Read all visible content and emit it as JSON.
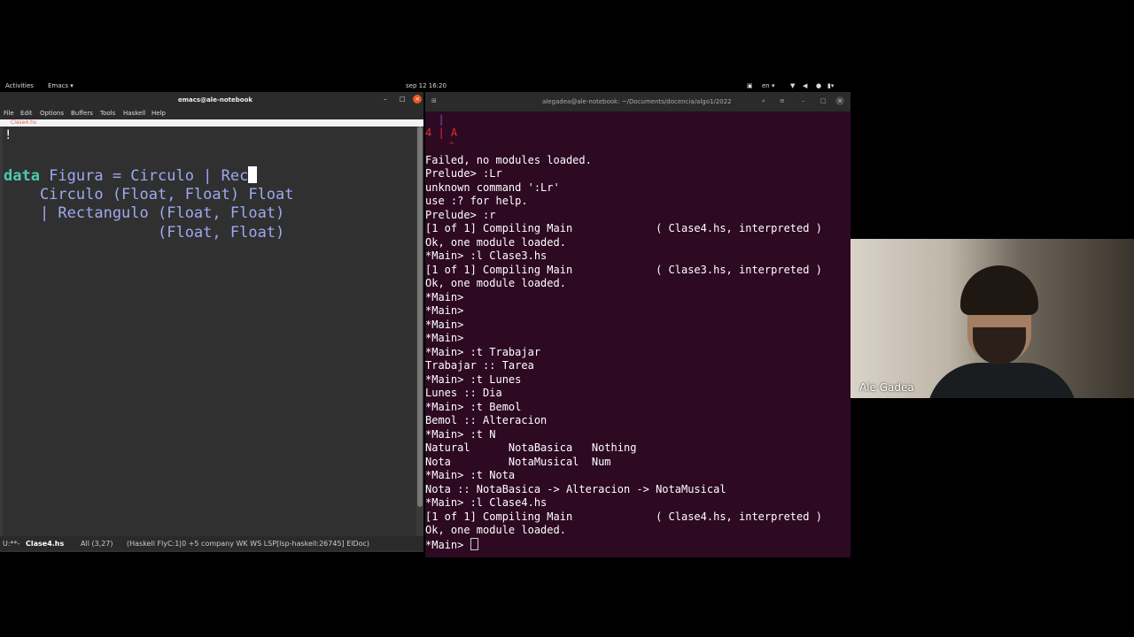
{
  "topbar": {
    "activities": "Activities",
    "app_menu": "Emacs ▾",
    "clock": "sep 12  16:20",
    "lang": "en ▾"
  },
  "emacs": {
    "title": "emacs@ale-notebook",
    "menu": [
      "File",
      "Edit",
      "Options",
      "Buffers",
      "Tools",
      "Haskell",
      "Help"
    ],
    "tab": "Clase4.hs",
    "code": {
      "line1_kw": "data",
      "line1_rest": " Figura = Circulo | Rec",
      "line2": "    Circulo (Float, Float) Float",
      "line3": "    | Rectangulo (Float, Float)",
      "line4": "                 (Float, Float)"
    },
    "modeline": {
      "status": "U:**-",
      "buffer": "Clase4.hs",
      "position": "All (3,27)",
      "modes": "(Haskell FlyC:1|0 +5 company WK WS LSP[lsp-haskell:26745] ElDoc)"
    }
  },
  "terminal": {
    "title": "alegadea@ale-notebook: ~/Documents/docencia/algo1/2022",
    "error_marker": "4 | A",
    "lines": [
      "Failed, no modules loaded.",
      "Prelude> :Lr",
      "unknown command ':Lr'",
      "use :? for help.",
      "Prelude> :r",
      "[1 of 1] Compiling Main             ( Clase4.hs, interpreted )",
      "Ok, one module loaded.",
      "*Main> :l Clase3.hs",
      "[1 of 1] Compiling Main             ( Clase3.hs, interpreted )",
      "Ok, one module loaded.",
      "*Main>",
      "*Main>",
      "*Main>",
      "*Main>",
      "*Main> :t Trabajar",
      "Trabajar :: Tarea",
      "*Main> :t Lunes",
      "Lunes :: Dia",
      "*Main> :t Bemol",
      "Bemol :: Alteracion",
      "*Main> :t N",
      "Natural      NotaBasica   Nothing",
      "Nota         NotaMusical  Num",
      "*Main> :t Nota",
      "Nota :: NotaBasica -> Alteracion -> NotaMusical",
      "*Main> :l Clase4.hs",
      "[1 of 1] Compiling Main             ( Clase4.hs, interpreted )",
      "Ok, one module loaded."
    ],
    "prompt": "*Main> "
  },
  "video": {
    "name": "Ale Gadea"
  }
}
